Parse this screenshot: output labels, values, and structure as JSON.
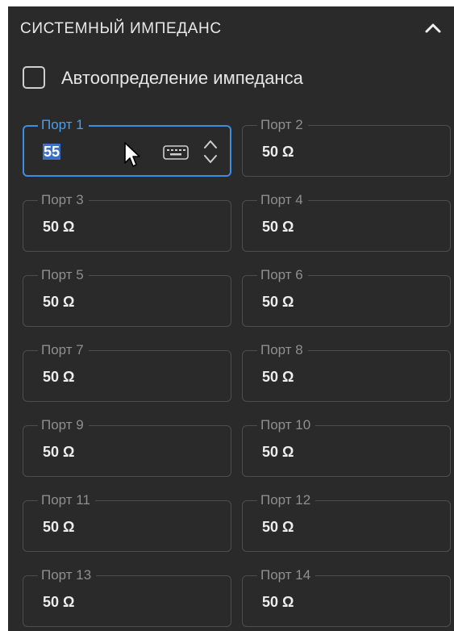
{
  "panel": {
    "title": "СИСТЕМНЫЙ ИМПЕДАНС",
    "collapse_icon": "chevron-up-icon"
  },
  "auto_detect": {
    "label": "Автоопределение импеданса",
    "checked": false
  },
  "ports": [
    {
      "label": "Порт 1",
      "value": "55",
      "focused": true,
      "value_selected": true
    },
    {
      "label": "Порт 2",
      "value": "50 Ω"
    },
    {
      "label": "Порт 3",
      "value": "50 Ω"
    },
    {
      "label": "Порт 4",
      "value": "50 Ω"
    },
    {
      "label": "Порт 5",
      "value": "50 Ω"
    },
    {
      "label": "Порт 6",
      "value": "50 Ω"
    },
    {
      "label": "Порт 7",
      "value": "50 Ω"
    },
    {
      "label": "Порт 8",
      "value": "50 Ω"
    },
    {
      "label": "Порт 9",
      "value": "50 Ω"
    },
    {
      "label": "Порт 10",
      "value": "50 Ω"
    },
    {
      "label": "Порт 11",
      "value": "50 Ω"
    },
    {
      "label": "Порт 12",
      "value": "50 Ω"
    },
    {
      "label": "Порт 13",
      "value": "50 Ω"
    },
    {
      "label": "Порт 14",
      "value": "50 Ω"
    }
  ],
  "active_field_icons": [
    "keyboard-icon",
    "spinner-icon",
    "mouse-cursor-icon"
  ],
  "colors": {
    "panel_bg": "#2a2a2a",
    "accent": "#3b8ee0",
    "field_border": "#4d4d4d",
    "label_text": "#8f8f8f",
    "value_text": "#ededed"
  }
}
